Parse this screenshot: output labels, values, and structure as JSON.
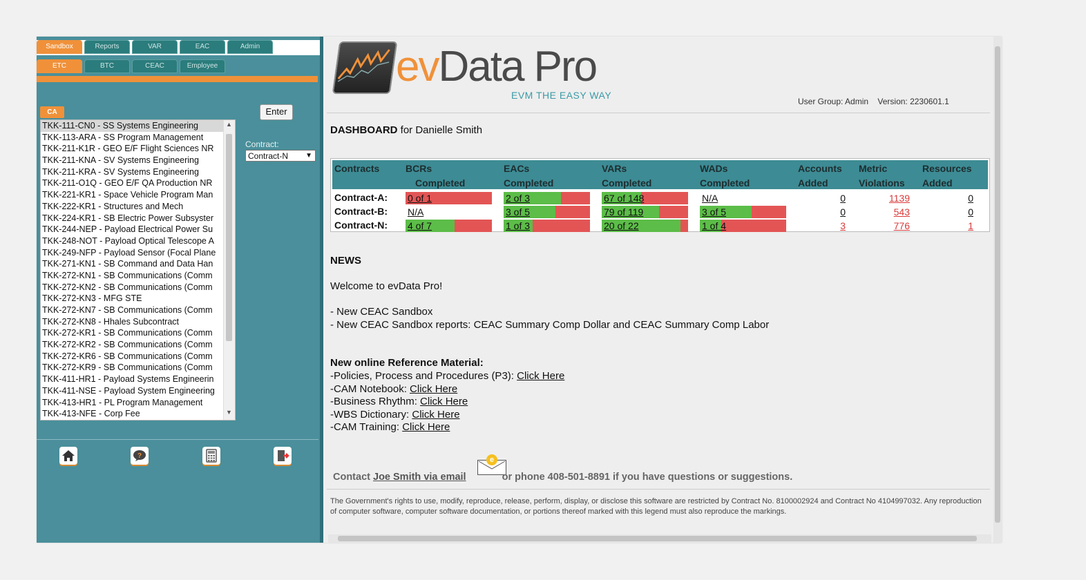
{
  "tabs_top": [
    {
      "label": "Sandbox",
      "active": true
    },
    {
      "label": "Reports",
      "active": false
    },
    {
      "label": "VAR",
      "active": false
    },
    {
      "label": "EAC",
      "active": false
    },
    {
      "label": "Admin",
      "active": false
    }
  ],
  "tabs_sub": [
    {
      "label": "ETC",
      "active": true
    },
    {
      "label": "BTC",
      "active": false
    },
    {
      "label": "CEAC",
      "active": false
    },
    {
      "label": "Employee",
      "active": false
    }
  ],
  "left": {
    "ca_label": "CA",
    "enter_label": "Enter",
    "contract_label": "Contract:",
    "contract_value": "Contract-N",
    "ca_items": [
      "TKK-111-CN0 - SS Systems Engineering",
      "TKK-113-ARA - SS Program Management",
      "TKK-211-K1R - GEO E/F Flight Sciences NR",
      "TKK-211-KNA - SV Systems Engineering",
      "TKK-211-KRA - SV Systems Engineering",
      "TKK-211-O1Q - GEO E/F QA Production NR",
      "TKK-221-KR1 - Space Vehicle Program Man",
      "TKK-222-KR1 - Structures and Mech",
      "TKK-224-KR1 - SB Electric Power Subsyster",
      "TKK-244-NEP - Payload Electrical Power Su",
      "TKK-248-NOT - Payload Optical Telescope A",
      "TKK-249-NFP - Payload Sensor (Focal Plane",
      "TKK-271-KN1 - SB Command and Data Han",
      "TKK-272-KN1 - SB Communications (Comm",
      "TKK-272-KN2 - SB Communications (Comm",
      "TKK-272-KN3 - MFG STE",
      "TKK-272-KN7 - SB Communications (Comm",
      "TKK-272-KN8 - Hhales Subcontract",
      "TKK-272-KR1 - SB Communications (Comm",
      "TKK-272-KR2 - SB Communications (Comm",
      "TKK-272-KR6 - SB Communications (Comm",
      "TKK-272-KR9 - SB Communications (Comm",
      "TKK-411-HR1 - Payload Systems Engineerin",
      "TKK-411-NSE - Payload System Engineering",
      "TKK-413-HR1 - PL Program Management",
      "TKK-413-NFE - Corp Fee"
    ],
    "nav_icons": [
      "home-icon",
      "help-icon",
      "calculator-icon",
      "logout-icon"
    ]
  },
  "header": {
    "logo_ev": "ev",
    "logo_rest": "Data Pro",
    "tagline": "EVM THE EASY WAY",
    "user_group": "User Group: Admin",
    "version": "Version: 2230601.1"
  },
  "dashboard": {
    "title_bold": "DASHBOARD",
    "title_rest": " for Danielle Smith",
    "headers": {
      "contracts": "Contracts",
      "bcrs": "BCRs",
      "eacs": "EACs",
      "vars": "VARs",
      "wads": "WADs",
      "completed": "Completed",
      "accounts": "Accounts",
      "added": "Added",
      "metric": "Metric",
      "violations": "Violations",
      "resources": "Resources"
    },
    "rows": [
      {
        "label": "Contract-A:",
        "bcrs": "0 of 1",
        "eacs": "2 of 3",
        "vars": "67 of 148",
        "wads": "N/A",
        "accounts": "0",
        "metric": "1139",
        "resources": "0"
      },
      {
        "label": "Contract-B:",
        "bcrs": "N/A",
        "eacs": "3 of 5",
        "vars": "79 of 119",
        "wads": "3 of 5",
        "accounts": "0",
        "metric": "543",
        "resources": "0"
      },
      {
        "label": "Contract-N:",
        "bcrs": "4 of 7",
        "eacs": "1 of 3",
        "vars": "20 of 22",
        "wads": "1 of 4",
        "accounts": "3",
        "metric": "776",
        "resources": "1"
      }
    ],
    "colors": {
      "green": "#5cbd48",
      "red": "#e35555",
      "header": "#3d8b94"
    }
  },
  "news": {
    "title": "NEWS",
    "welcome": "Welcome to evData Pro!",
    "items": [
      "- New CEAC Sandbox",
      "- New CEAC Sandbox reports: CEAC Summary Comp Dollar and CEAC Summary Comp Labor"
    ]
  },
  "reference": {
    "title": "New online Reference Material:",
    "links": [
      {
        "prefix": "-Policies, Process and Procedures (P3): ",
        "link": "Click Here"
      },
      {
        "prefix": "-CAM Notebook: ",
        "link": "Click Here"
      },
      {
        "prefix": "-Business Rhythm: ",
        "link": "Click Here"
      },
      {
        "prefix": "-WBS Dictionary: ",
        "link": "Click Here"
      },
      {
        "prefix": "-CAM Training: ",
        "link": "Click Here"
      }
    ]
  },
  "contact": {
    "prefix": "Contact ",
    "link": "Joe Smith via email",
    "suffix": " or phone 408-501-8891 if you have questions or suggestions.",
    "coin": "e"
  },
  "footer": "The Government's rights to use, modify, reproduce, release, perform, display, or disclose this software are restricted by Contract No. 8100002924 and Contract No 4104997032. Any reproduction of computer software, computer software documentation, or portions thereof marked with this legend must also reproduce the markings."
}
